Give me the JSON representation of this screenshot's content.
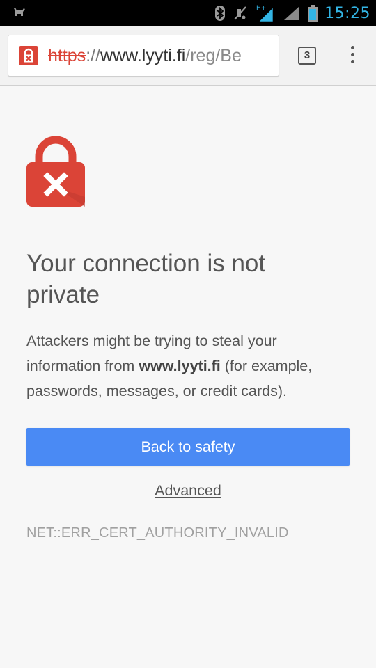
{
  "status_bar": {
    "time": "15:25",
    "network_type": "H+",
    "icons": [
      "cat-icon",
      "bluetooth-icon",
      "mute-icon",
      "signal-h-plus-icon",
      "signal-icon",
      "battery-icon"
    ]
  },
  "toolbar": {
    "url_scheme": "https",
    "url_separator": "://",
    "url_host": "www.lyyti.fi",
    "url_path": "/reg/Be",
    "tab_count": "3"
  },
  "interstitial": {
    "heading": "Your connection is not private",
    "body_prefix": "Attackers might be trying to steal your information from ",
    "body_host": "www.lyyti.fi",
    "body_suffix": " (for example, passwords, messages, or credit cards).",
    "primary_button": "Back to safety",
    "advanced_link": "Advanced",
    "error_code": "NET::ERR_CERT_AUTHORITY_INVALID"
  },
  "colors": {
    "status_accent": "#33b5e5",
    "error_red": "#db4437",
    "button_blue": "#4a8af4",
    "background": "#f7f7f7"
  }
}
